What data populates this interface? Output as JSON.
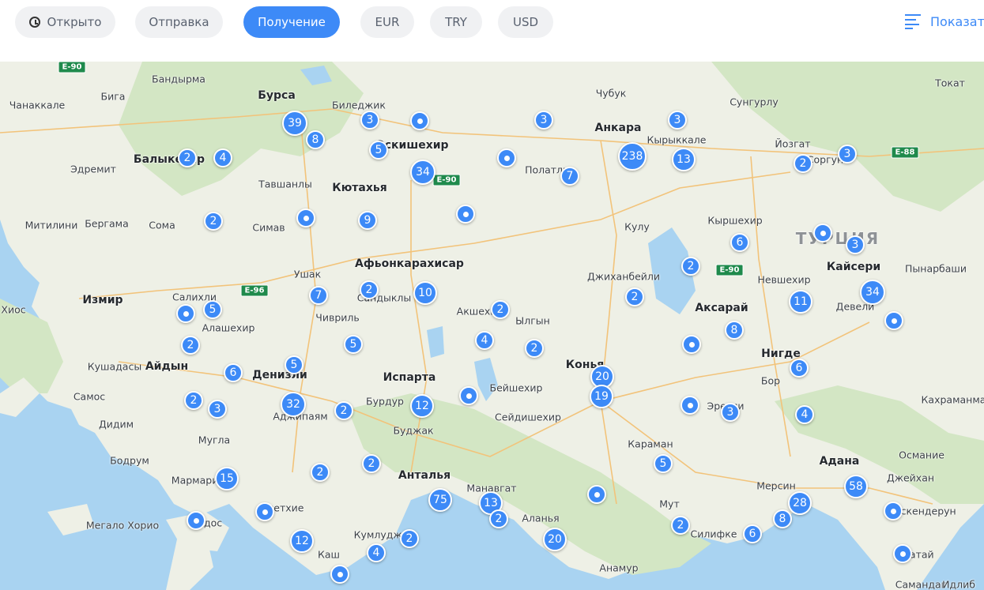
{
  "toolbar": {
    "filters": [
      {
        "label": "Открыто",
        "active": false
      },
      {
        "label": "Отправка",
        "active": false
      },
      {
        "label": "Получение",
        "active": true
      },
      {
        "label": "EUR",
        "active": false
      },
      {
        "label": "TRY",
        "active": false
      },
      {
        "label": "USD",
        "active": false
      }
    ],
    "show_label": "Показат"
  },
  "map": {
    "country_label": "ТУРЦИЯ",
    "cities": [
      "Бандырма",
      "Бурса",
      "Чанаккале",
      "Бига",
      "Биледжик",
      "Чубук",
      "Анкара",
      "Сунгурлу",
      "Токат",
      "Балыкесир",
      "Эскишехир",
      "Кырыккале",
      "Йозгат",
      "Соргун",
      "Эдремит",
      "Полатлы",
      "Тавшанлы",
      "Кютахья",
      "Кулу",
      "Кыршехир",
      "Митилини",
      "Бергама",
      "Сома",
      "Симав",
      "Афьонкарахисар",
      "Кайсери",
      "Пынарбаши",
      "Ушак",
      "Джиханбейли",
      "Невшехир",
      "Измир",
      "Салихли",
      "Сандыклы",
      "Аксарай",
      "Хиос",
      "Алашехир",
      "Чивриль",
      "Акшехир",
      "Ылгын",
      "Девели",
      "Конья",
      "Нигде",
      "Кушадасы",
      "Айдын",
      "Денизли",
      "Испарта",
      "Бейшехир",
      "Бор",
      "Самос",
      "Бурдур",
      "Эрегли",
      "Кахраманмараш",
      "Аджипаям",
      "Сейдишехир",
      "Дидим",
      "Муглa",
      "Буджак",
      "Караман",
      "Бодрум",
      "Адана",
      "Османие",
      "Мармарис",
      "Анталья",
      "Манавгат",
      "Мерсин",
      "Джейхан",
      "Фетхие",
      "Мут",
      "Искендерун",
      "Мегало Хорио",
      "Родос",
      "Аланья",
      "Силифке",
      "Кумлуджа",
      "Каш",
      "Хатай",
      "Анамур",
      "Самандаг",
      "Идлиб"
    ],
    "highways": [
      "E-90",
      "E-90",
      "E-96",
      "E-88",
      "E-90"
    ],
    "clusters": [
      "39",
      "3",
      "3",
      "3",
      "8",
      "2",
      "4",
      "5",
      "34",
      "238",
      "13",
      "2",
      "3",
      "7",
      "2",
      "9",
      "6",
      "3",
      "2",
      "7",
      "10",
      "2",
      "11",
      "34",
      "5",
      "2",
      "2",
      "4",
      "2",
      "8",
      "5",
      "2",
      "6",
      "5",
      "20",
      "19",
      "6",
      "2",
      "3",
      "32",
      "2",
      "12",
      "3",
      "4",
      "2",
      "5",
      "15",
      "2",
      "75",
      "13",
      "28",
      "58",
      "2",
      "8",
      "12",
      "2",
      "20",
      "2",
      "6",
      "4"
    ],
    "colors": {
      "marker": "#3d8af7",
      "water": "#a9d3f1",
      "land": "#eef0e6",
      "forest": "#d3e6c4"
    }
  }
}
